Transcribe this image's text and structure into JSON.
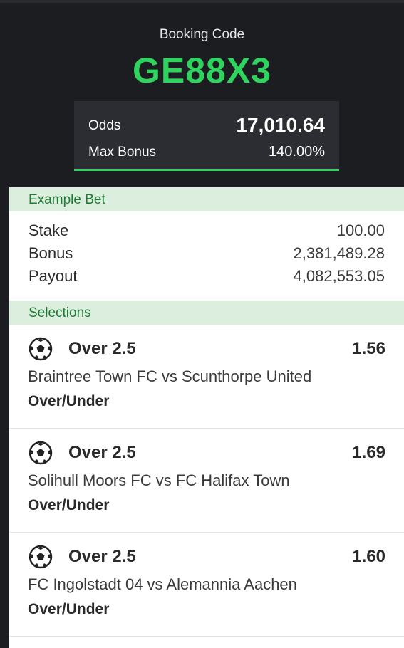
{
  "header": {
    "booking_label": "Booking Code",
    "booking_code": "GE88X3",
    "odds_label": "Odds",
    "odds_value": "17,010.64",
    "max_bonus_label": "Max Bonus",
    "max_bonus_value": "140.00%"
  },
  "example_bet": {
    "title": "Example Bet",
    "rows": [
      {
        "label": "Stake",
        "value": "100.00"
      },
      {
        "label": "Bonus",
        "value": "2,381,489.28"
      },
      {
        "label": "Payout",
        "value": "4,082,553.05"
      }
    ]
  },
  "selections": {
    "title": "Selections",
    "items": [
      {
        "icon": "soccer-ball-icon",
        "pick": "Over 2.5",
        "odds": "1.56",
        "match": "Braintree Town FC vs Scunthorpe United",
        "market": "Over/Under"
      },
      {
        "icon": "soccer-ball-icon",
        "pick": "Over 2.5",
        "odds": "1.69",
        "match": "Solihull Moors FC vs FC Halifax Town",
        "market": "Over/Under"
      },
      {
        "icon": "soccer-ball-icon",
        "pick": "Over 2.5",
        "odds": "1.60",
        "match": "FC Ingolstadt 04 vs Alemannia Aachen",
        "market": "Over/Under"
      }
    ]
  },
  "colors": {
    "accent_green": "#2fd45f",
    "header_bg": "#1c1d21",
    "section_bg": "#dcefdf",
    "section_text": "#1f7a34"
  }
}
